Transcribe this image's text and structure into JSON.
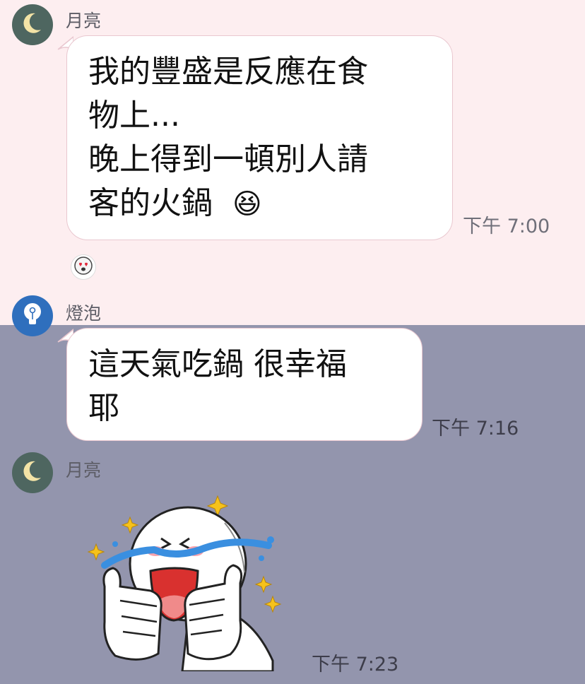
{
  "messages": [
    {
      "sender": "月亮",
      "avatar_icon": "moon-icon",
      "lines": [
        "我的豐盛是反應在食",
        "物上...",
        "晚上得到一頓別人請",
        "客的火鍋"
      ],
      "emoji": "😆",
      "time": "下午 7:00",
      "reaction_icon": "heart-eyes-emoji-icon"
    },
    {
      "sender": "燈泡",
      "avatar_icon": "lightbulb-icon",
      "lines": [
        "這天氣吃鍋 很幸福",
        "耶"
      ],
      "time": "下午 7:16"
    },
    {
      "sender": "月亮",
      "avatar_icon": "moon-icon",
      "sticker_icon": "crying-thumbs-up-sticker-icon",
      "time": "下午 7:23"
    }
  ],
  "colors": {
    "top_background": "#fdeef0",
    "bottom_background": "#9395ad",
    "bubble": "#ffffff",
    "bubble_border": "#e9c7cf",
    "moon_avatar": "#4e6660",
    "bulb_avatar": "#2f6fbd"
  }
}
